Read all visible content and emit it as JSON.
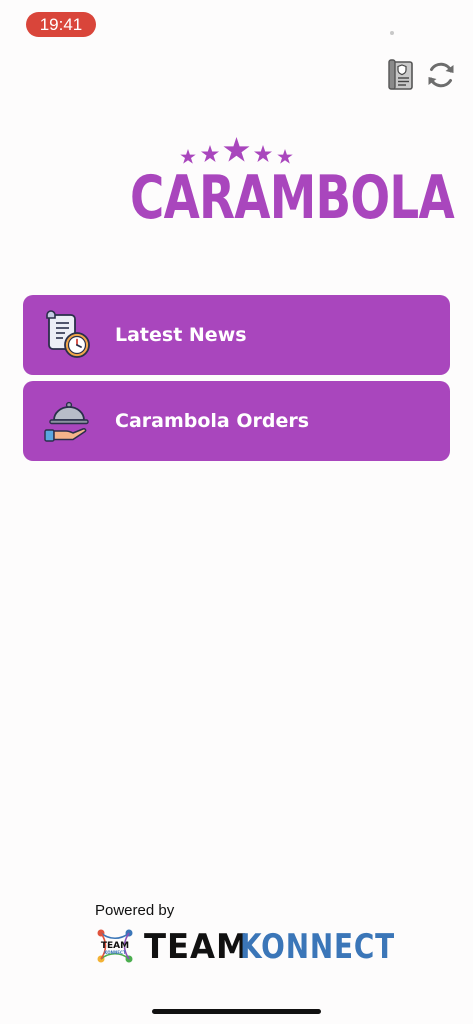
{
  "status_bar": {
    "time": "19:41",
    "time_pill_color": "#d9453a"
  },
  "top_actions": [
    {
      "icon": "policy-document-icon"
    },
    {
      "icon": "refresh-icon"
    }
  ],
  "logo": {
    "text": "CARAMBOLA",
    "stars": 5,
    "color": "#a946bd"
  },
  "menu": [
    {
      "label": "Latest News",
      "icon": "news-scroll-clock-icon"
    },
    {
      "label": "Carambola Orders",
      "icon": "serving-cloche-hand-icon"
    }
  ],
  "menu_color": "#a946bd",
  "footer": {
    "powered_by": "Powered by",
    "brand_part1": "TEAM",
    "brand_part2": "KONNECT",
    "brand_badge_text": "TEAM",
    "brand_badge_subtext": "KONNECT",
    "brand_color": "#3b76b8"
  }
}
